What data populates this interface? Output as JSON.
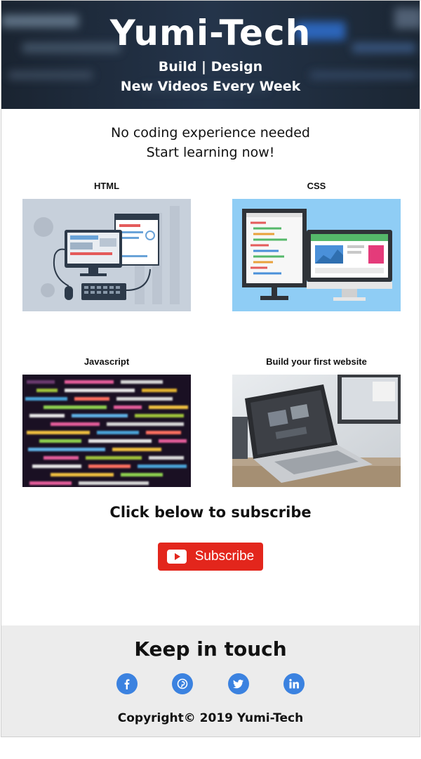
{
  "hero": {
    "title": "Yumi-Tech",
    "line1": "Build | Design",
    "line2": "New Videos Every Week"
  },
  "intro": {
    "line1": "No coding experience needed",
    "line2": "Start learning now!"
  },
  "cards": [
    {
      "label": "HTML",
      "image": "html-illustration"
    },
    {
      "label": "CSS",
      "image": "css-illustration"
    },
    {
      "label": "Javascript",
      "image": "javascript-code-photo"
    },
    {
      "label": "Build your first website",
      "image": "laptop-photo"
    }
  ],
  "subscribe": {
    "title": "Click below to subscribe",
    "button_label": "Subscribe",
    "button_color": "#e3261c"
  },
  "footer": {
    "title": "Keep in touch",
    "socials": [
      "facebook-icon",
      "pinterest-icon",
      "twitter-icon",
      "linkedin-icon"
    ],
    "social_color": "#3b82e0",
    "copyright": "Copyright© 2019 Yumi-Tech"
  }
}
